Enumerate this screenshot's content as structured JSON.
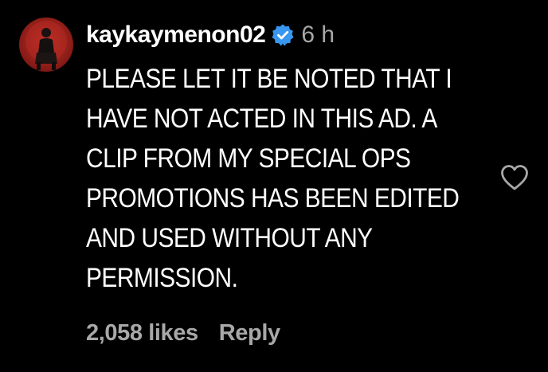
{
  "comment": {
    "username": "kaykaymenon02",
    "time": "6 h",
    "text_lines": [
      "PLEASE LET IT BE NOTED THAT I",
      "HAVE NOT ACTED IN THIS AD. A",
      "CLIP FROM MY SPECIAL OPS",
      "PROMOTIONS HAS BEEN EDITED",
      "AND USED WITHOUT ANY",
      "PERMISSION."
    ],
    "likes": "2,058 likes",
    "reply_label": "Reply"
  },
  "icons": {
    "avatar": "profile-avatar",
    "verified": "verified-badge-icon",
    "like": "heart-outline-icon"
  },
  "colors": {
    "background": "#000000",
    "text": "#ffffff",
    "muted": "#a8a8a8",
    "verified": "#3897f0"
  }
}
